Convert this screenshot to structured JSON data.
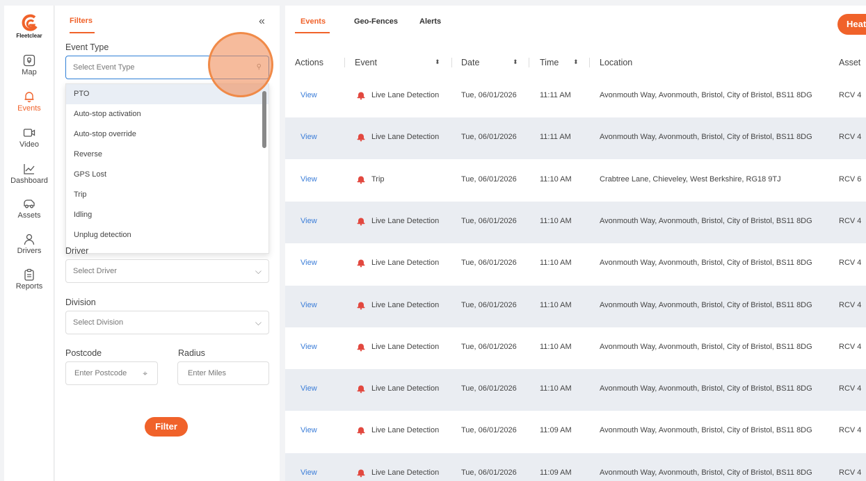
{
  "nav": {
    "logo_text": "Fleetclear",
    "items": [
      {
        "label": "Map",
        "icon": "map-pin-icon"
      },
      {
        "label": "Events",
        "icon": "bell-icon"
      },
      {
        "label": "Video",
        "icon": "video-icon"
      },
      {
        "label": "Dashboard",
        "icon": "chart-line-icon"
      },
      {
        "label": "Assets",
        "icon": "truck-icon"
      },
      {
        "label": "Drivers",
        "icon": "user-icon"
      },
      {
        "label": "Reports",
        "icon": "clipboard-icon"
      }
    ],
    "active": "Events"
  },
  "filters": {
    "title": "Filters",
    "collapse_icon": "«",
    "event_type_label": "Event Type",
    "event_type_placeholder": "Select Event Type",
    "event_type_options": [
      "PTO",
      "Auto-stop activation",
      "Auto-stop override",
      "Reverse",
      "GPS Lost",
      "Trip",
      "Idling",
      "Unplug detection"
    ],
    "driver_label": "Driver",
    "driver_placeholder": "Select Driver",
    "division_label": "Division",
    "division_placeholder": "Select Division",
    "postcode_label": "Postcode",
    "postcode_placeholder": "Enter Postcode",
    "radius_label": "Radius",
    "radius_placeholder": "Enter Miles",
    "filter_button": "Filter"
  },
  "tabs": [
    "Events",
    "Geo-Fences",
    "Alerts"
  ],
  "heat_button": "Heat",
  "table": {
    "headers": [
      "Actions",
      "Event",
      "Date",
      "Time",
      "Location",
      "Asset"
    ],
    "rows": [
      {
        "action": "View",
        "event": "Live Lane Detection",
        "date": "Tue, 06/01/2026",
        "time": "11:11 AM",
        "location": "Avonmouth Way, Avonmouth, Bristol, City of Bristol, BS11 8DG",
        "asset": "RCV 4"
      },
      {
        "action": "View",
        "event": "Live Lane Detection",
        "date": "Tue, 06/01/2026",
        "time": "11:11 AM",
        "location": "Avonmouth Way, Avonmouth, Bristol, City of Bristol, BS11 8DG",
        "asset": "RCV 4"
      },
      {
        "action": "View",
        "event": "Trip",
        "date": "Tue, 06/01/2026",
        "time": "11:10 AM",
        "location": "Crabtree Lane, Chieveley, West Berkshire, RG18 9TJ",
        "asset": "RCV 6"
      },
      {
        "action": "View",
        "event": "Live Lane Detection",
        "date": "Tue, 06/01/2026",
        "time": "11:10 AM",
        "location": "Avonmouth Way, Avonmouth, Bristol, City of Bristol, BS11 8DG",
        "asset": "RCV 4"
      },
      {
        "action": "View",
        "event": "Live Lane Detection",
        "date": "Tue, 06/01/2026",
        "time": "11:10 AM",
        "location": "Avonmouth Way, Avonmouth, Bristol, City of Bristol, BS11 8DG",
        "asset": "RCV 4"
      },
      {
        "action": "View",
        "event": "Live Lane Detection",
        "date": "Tue, 06/01/2026",
        "time": "11:10 AM",
        "location": "Avonmouth Way, Avonmouth, Bristol, City of Bristol, BS11 8DG",
        "asset": "RCV 4"
      },
      {
        "action": "View",
        "event": "Live Lane Detection",
        "date": "Tue, 06/01/2026",
        "time": "11:10 AM",
        "location": "Avonmouth Way, Avonmouth, Bristol, City of Bristol, BS11 8DG",
        "asset": "RCV 4"
      },
      {
        "action": "View",
        "event": "Live Lane Detection",
        "date": "Tue, 06/01/2026",
        "time": "11:10 AM",
        "location": "Avonmouth Way, Avonmouth, Bristol, City of Bristol, BS11 8DG",
        "asset": "RCV 4"
      },
      {
        "action": "View",
        "event": "Live Lane Detection",
        "date": "Tue, 06/01/2026",
        "time": "11:09 AM",
        "location": "Avonmouth Way, Avonmouth, Bristol, City of Bristol, BS11 8DG",
        "asset": "RCV 4"
      },
      {
        "action": "View",
        "event": "Live Lane Detection",
        "date": "Tue, 06/01/2026",
        "time": "11:09 AM",
        "location": "Avonmouth Way, Avonmouth, Bristol, City of Bristol, BS11 8DG",
        "asset": "RCV 4"
      }
    ]
  },
  "colors": {
    "accent": "#f0622a",
    "link": "#3b7dd8",
    "row_alt": "#eaedf2",
    "alert_icon": "#e2483f"
  }
}
